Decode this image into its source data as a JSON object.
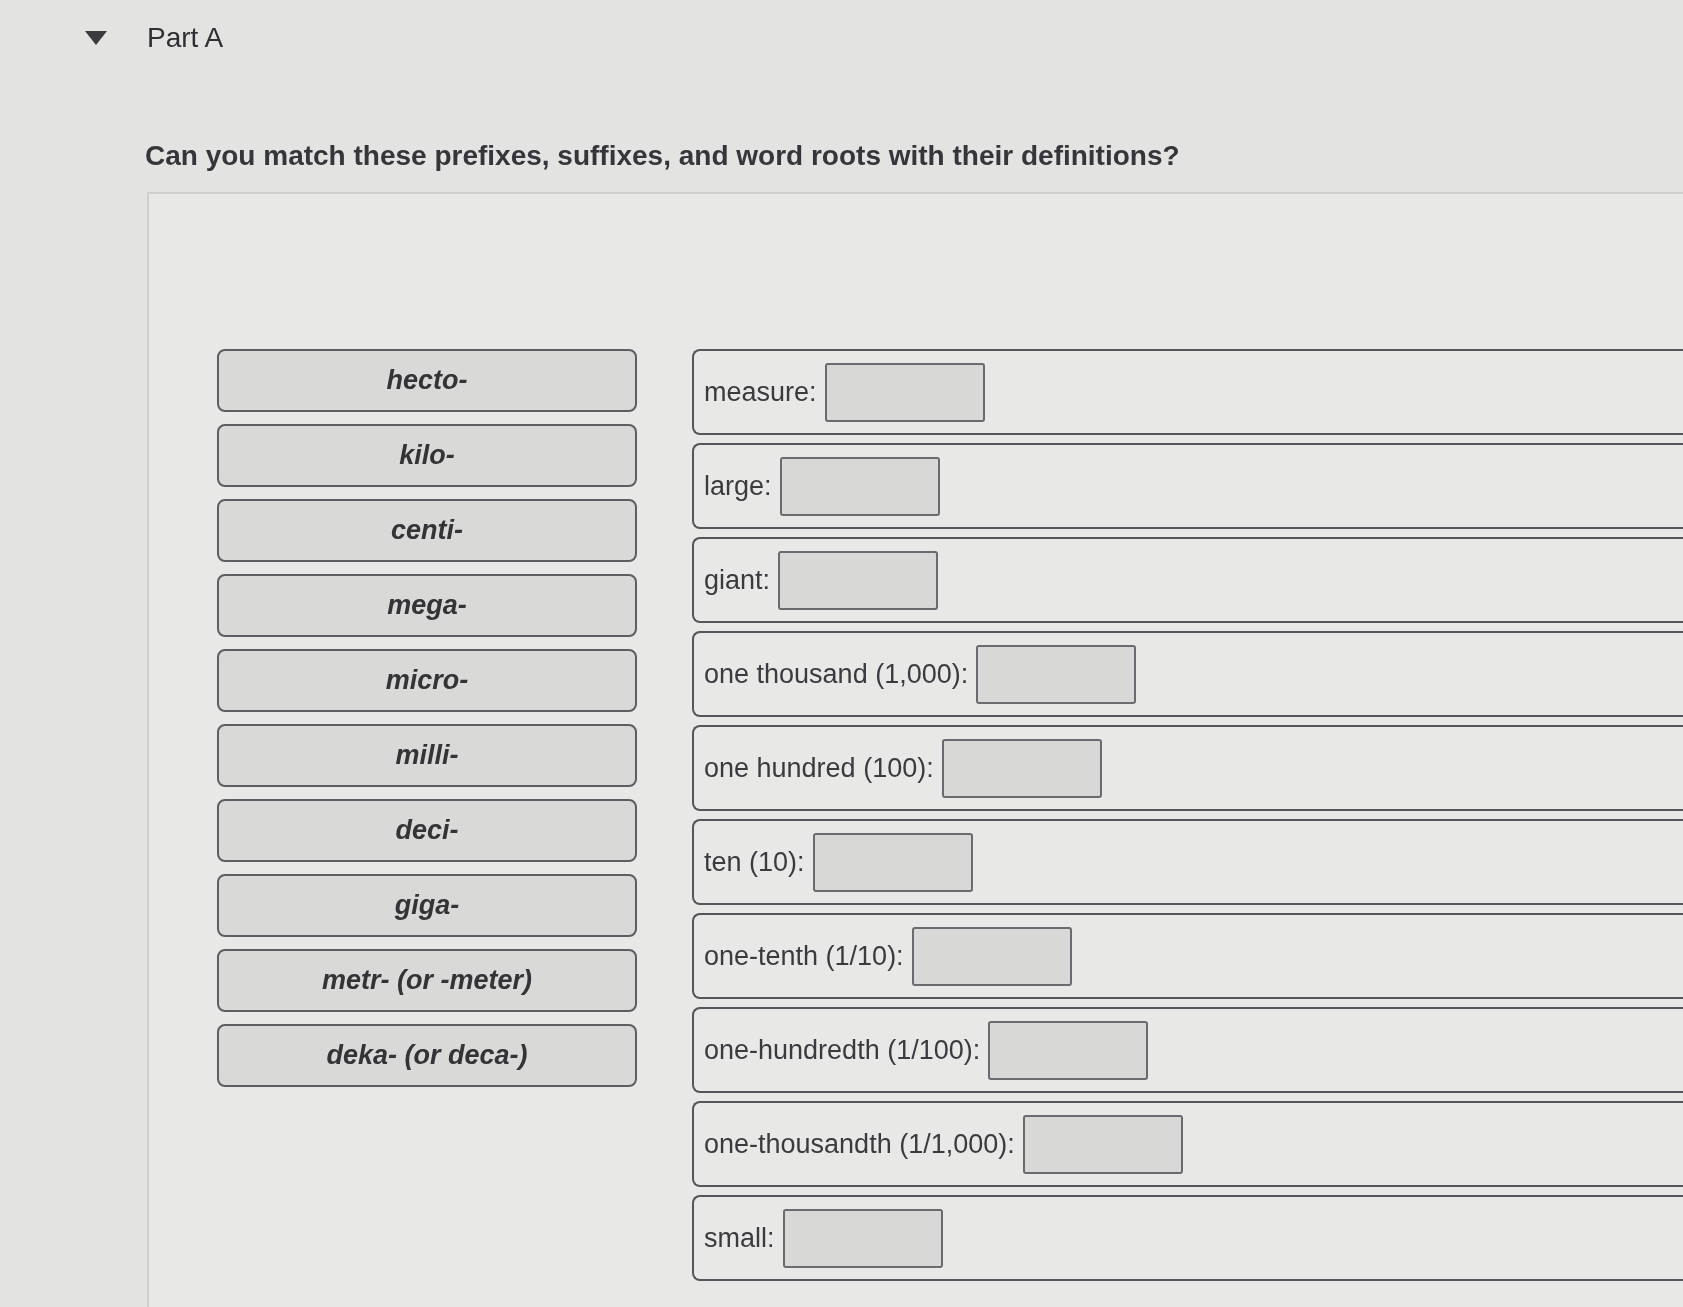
{
  "section": {
    "title": "Part A",
    "expanded": true
  },
  "question": "Can you match these prefixes, suffixes, and word roots with their definitions?",
  "terms": [
    {
      "label": "hecto-"
    },
    {
      "label": "kilo-"
    },
    {
      "label": "centi-"
    },
    {
      "label": "mega-"
    },
    {
      "label": "micro-"
    },
    {
      "label": "milli-"
    },
    {
      "label": "deci-"
    },
    {
      "label": "giga-"
    },
    {
      "label": "metr- (or -meter)"
    },
    {
      "label": "deka- (or deca-)"
    }
  ],
  "targets": [
    {
      "label": "measure:"
    },
    {
      "label": "large:"
    },
    {
      "label": "giant:"
    },
    {
      "label": "one thousand (1,000):"
    },
    {
      "label": "one hundred (100):"
    },
    {
      "label": "ten (10):"
    },
    {
      "label": "one-tenth (1/10):"
    },
    {
      "label": "one-hundredth (1/100):"
    },
    {
      "label": "one-thousandth (1/1,000):"
    },
    {
      "label": "small:"
    }
  ]
}
